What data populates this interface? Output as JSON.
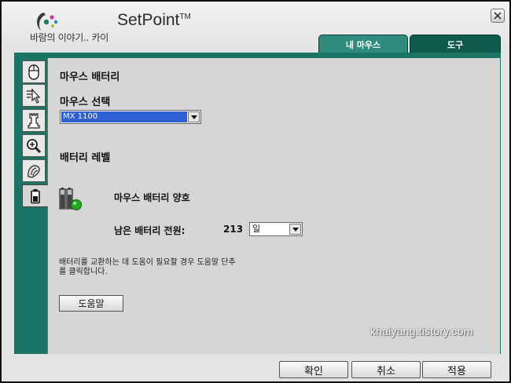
{
  "header": {
    "app_title": "SetPoint",
    "trademark": "TM",
    "overlay_text": "바람의 이야기.. 카이"
  },
  "tabs": [
    {
      "label": "내 마우스",
      "active": true
    },
    {
      "label": "도구",
      "active": false
    }
  ],
  "sidebar": {
    "items": [
      {
        "icon": "mouse-icon"
      },
      {
        "icon": "pointer-speed-icon"
      },
      {
        "icon": "chess-game-icon"
      },
      {
        "icon": "zoom-icon"
      },
      {
        "icon": "hand-grip-icon"
      },
      {
        "icon": "battery-icon",
        "active": true
      }
    ]
  },
  "main": {
    "section_title": "마우스 배터리",
    "select_label": "마우스 선택",
    "mouse_select": {
      "value": "MX 1100"
    },
    "battery_level_label": "배터리 레벨",
    "battery_status": "마우스 배터리 양호",
    "remaining_label": "남은 배터리 전원:",
    "remaining_value": "213",
    "unit_select": {
      "value": "일"
    },
    "help_text_line1": "배터리를 교환하는 데 도움이 필요할 경우 도움말 단추",
    "help_text_line2": "를 클릭합니다.",
    "help_button": "도움말"
  },
  "watermark": "khaiyang.tistory.com",
  "footer": {
    "ok": "확인",
    "cancel": "취소",
    "apply": "적용"
  },
  "colors": {
    "teal_dark": "#1a7566",
    "tab_active": "#2f8b7b",
    "tab_inactive": "#0f5a4c",
    "select_highlight": "#2f5fd1",
    "battery_ok": "#22aa22"
  }
}
